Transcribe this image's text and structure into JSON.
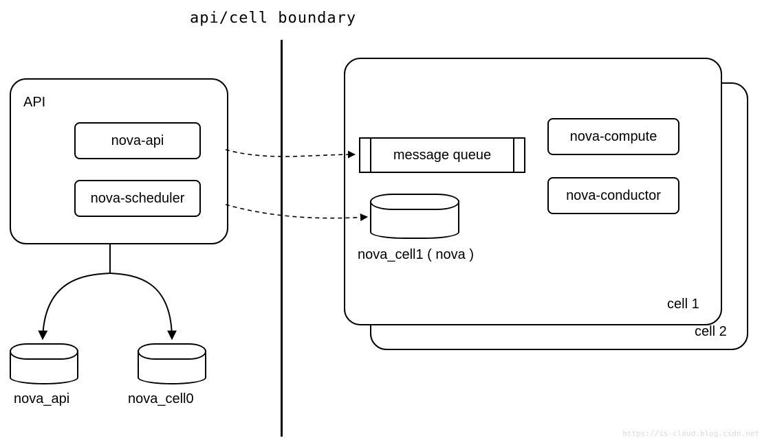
{
  "title": "api/cell boundary",
  "api": {
    "heading": "API",
    "nova_api": "nova-api",
    "nova_scheduler": "nova-scheduler"
  },
  "dbs": {
    "nova_api": "nova_api",
    "nova_cell0": "nova_cell0",
    "nova_cell1": "nova_cell1  ( nova )"
  },
  "cell": {
    "mq": "message queue",
    "nova_compute": "nova-compute",
    "nova_conductor": "nova-conductor",
    "cell1": "cell 1",
    "cell2": "cell 2"
  },
  "watermark": "https://is-cloud.blog.csdn.net"
}
